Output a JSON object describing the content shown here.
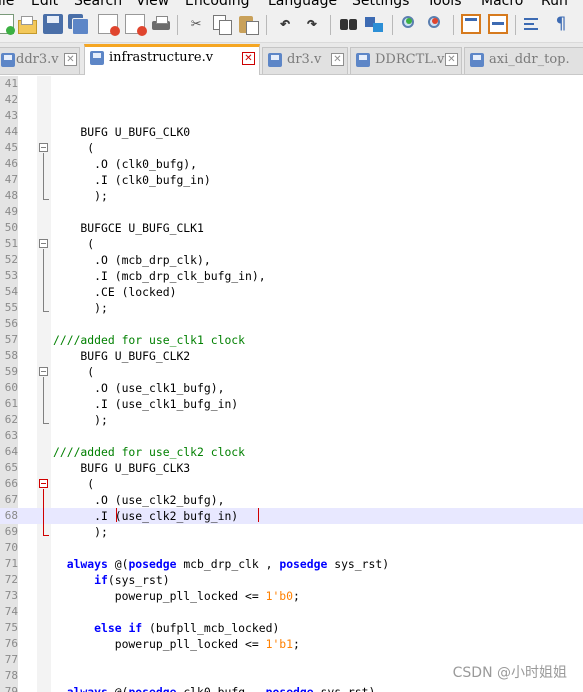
{
  "menu": [
    "ile",
    "Edit",
    "Search",
    "View",
    "Encoding",
    "Language",
    "Settings",
    "Tools",
    "Macro",
    "Run"
  ],
  "toolbar": {
    "buttons": [
      "new-file-icon",
      "open-file-icon",
      "save-icon",
      "save-all-icon",
      "close-icon",
      "close-all-icon",
      "print-icon",
      "cut-icon",
      "copy-icon",
      "paste-icon",
      "undo-icon",
      "redo-icon",
      "find-icon",
      "replace-icon",
      "zoom-in-icon",
      "zoom-out-icon",
      "sync-vertical-icon",
      "sync-horizontal-icon",
      "word-wrap-icon",
      "show-all-chars-icon"
    ]
  },
  "tabs": [
    {
      "label": "ddr3.v",
      "active": false
    },
    {
      "label": "infrastructure.v",
      "active": true
    },
    {
      "label": "dr3.v",
      "active": false
    },
    {
      "label": "DDRCTL.v",
      "active": false
    },
    {
      "label": "axi_ddr_top.",
      "active": false
    }
  ],
  "editor": {
    "lines": [
      {
        "n": "41",
        "segs": []
      },
      {
        "n": "42",
        "segs": []
      },
      {
        "n": "43",
        "segs": []
      },
      {
        "n": "44",
        "segs": [
          {
            "t": "    BUFG U_BUFG_CLK0"
          }
        ]
      },
      {
        "n": "45",
        "segs": [
          {
            "t": "     ("
          }
        ]
      },
      {
        "n": "46",
        "segs": [
          {
            "t": "      .O (clk0_bufg),"
          }
        ]
      },
      {
        "n": "47",
        "segs": [
          {
            "t": "      .I (clk0_bufg_in)"
          }
        ]
      },
      {
        "n": "48",
        "segs": [
          {
            "t": "      );"
          }
        ]
      },
      {
        "n": "49",
        "segs": []
      },
      {
        "n": "50",
        "segs": [
          {
            "t": "    BUFGCE U_BUFG_CLK1"
          }
        ]
      },
      {
        "n": "51",
        "segs": [
          {
            "t": "     ("
          }
        ]
      },
      {
        "n": "52",
        "segs": [
          {
            "t": "      .O (mcb_drp_clk),"
          }
        ]
      },
      {
        "n": "53",
        "segs": [
          {
            "t": "      .I (mcb_drp_clk_bufg_in),"
          }
        ]
      },
      {
        "n": "54",
        "segs": [
          {
            "t": "      .CE (locked)"
          }
        ]
      },
      {
        "n": "55",
        "segs": [
          {
            "t": "      );"
          }
        ]
      },
      {
        "n": "56",
        "segs": []
      },
      {
        "n": "57",
        "segs": [
          {
            "t": "////added for use_clk1 clock",
            "c": "cm"
          }
        ]
      },
      {
        "n": "58",
        "segs": [
          {
            "t": "    BUFG U_BUFG_CLK2"
          }
        ]
      },
      {
        "n": "59",
        "segs": [
          {
            "t": "     ("
          }
        ]
      },
      {
        "n": "60",
        "segs": [
          {
            "t": "      .O (use_clk1_bufg),"
          }
        ]
      },
      {
        "n": "61",
        "segs": [
          {
            "t": "      .I (use_clk1_bufg_in)"
          }
        ]
      },
      {
        "n": "62",
        "segs": [
          {
            "t": "      );"
          }
        ]
      },
      {
        "n": "63",
        "segs": []
      },
      {
        "n": "64",
        "segs": [
          {
            "t": "////added for use_clk2 clock",
            "c": "cm"
          }
        ]
      },
      {
        "n": "65",
        "segs": [
          {
            "t": "    BUFG U_BUFG_CLK3"
          }
        ]
      },
      {
        "n": "66",
        "segs": [
          {
            "t": "     ("
          }
        ]
      },
      {
        "n": "67",
        "segs": [
          {
            "t": "      .O (use_clk2_bufg),"
          }
        ]
      },
      {
        "n": "68",
        "segs": [
          {
            "t": "      .I (use_clk2_bufg_in)"
          }
        ]
      },
      {
        "n": "69",
        "segs": [
          {
            "t": "      );"
          }
        ]
      },
      {
        "n": "70",
        "segs": []
      },
      {
        "n": "71",
        "segs": [
          {
            "t": "  "
          },
          {
            "t": "always",
            "c": "kw"
          },
          {
            "t": " @(",
            "c": "plain"
          },
          {
            "t": "posedge",
            "c": "kw"
          },
          {
            "t": " mcb_drp_clk , "
          },
          {
            "t": "posedge",
            "c": "kw"
          },
          {
            "t": " sys_rst)"
          }
        ]
      },
      {
        "n": "72",
        "segs": [
          {
            "t": "      "
          },
          {
            "t": "if",
            "c": "kw"
          },
          {
            "t": "(sys_rst)"
          }
        ]
      },
      {
        "n": "73",
        "segs": [
          {
            "t": "         powerup_pll_locked <= "
          },
          {
            "t": "1'b0",
            "c": "num"
          },
          {
            "t": ";"
          }
        ]
      },
      {
        "n": "74",
        "segs": []
      },
      {
        "n": "75",
        "segs": [
          {
            "t": "      "
          },
          {
            "t": "else if",
            "c": "kw"
          },
          {
            "t": " (bufpll_mcb_locked)"
          }
        ]
      },
      {
        "n": "76",
        "segs": [
          {
            "t": "         powerup_pll_locked <= "
          },
          {
            "t": "1'b1",
            "c": "num"
          },
          {
            "t": ";"
          }
        ]
      },
      {
        "n": "77",
        "segs": []
      },
      {
        "n": "78",
        "segs": []
      },
      {
        "n": "79",
        "segs": [
          {
            "t": "  "
          },
          {
            "t": "always",
            "c": "kw"
          },
          {
            "t": " @("
          },
          {
            "t": "posedge",
            "c": "kw"
          },
          {
            "t": " clk0_bufg , "
          },
          {
            "t": "posedge",
            "c": "kw"
          },
          {
            "t": " sys_rst)"
          }
        ]
      }
    ]
  },
  "watermark": "CSDN @小时姐姐"
}
